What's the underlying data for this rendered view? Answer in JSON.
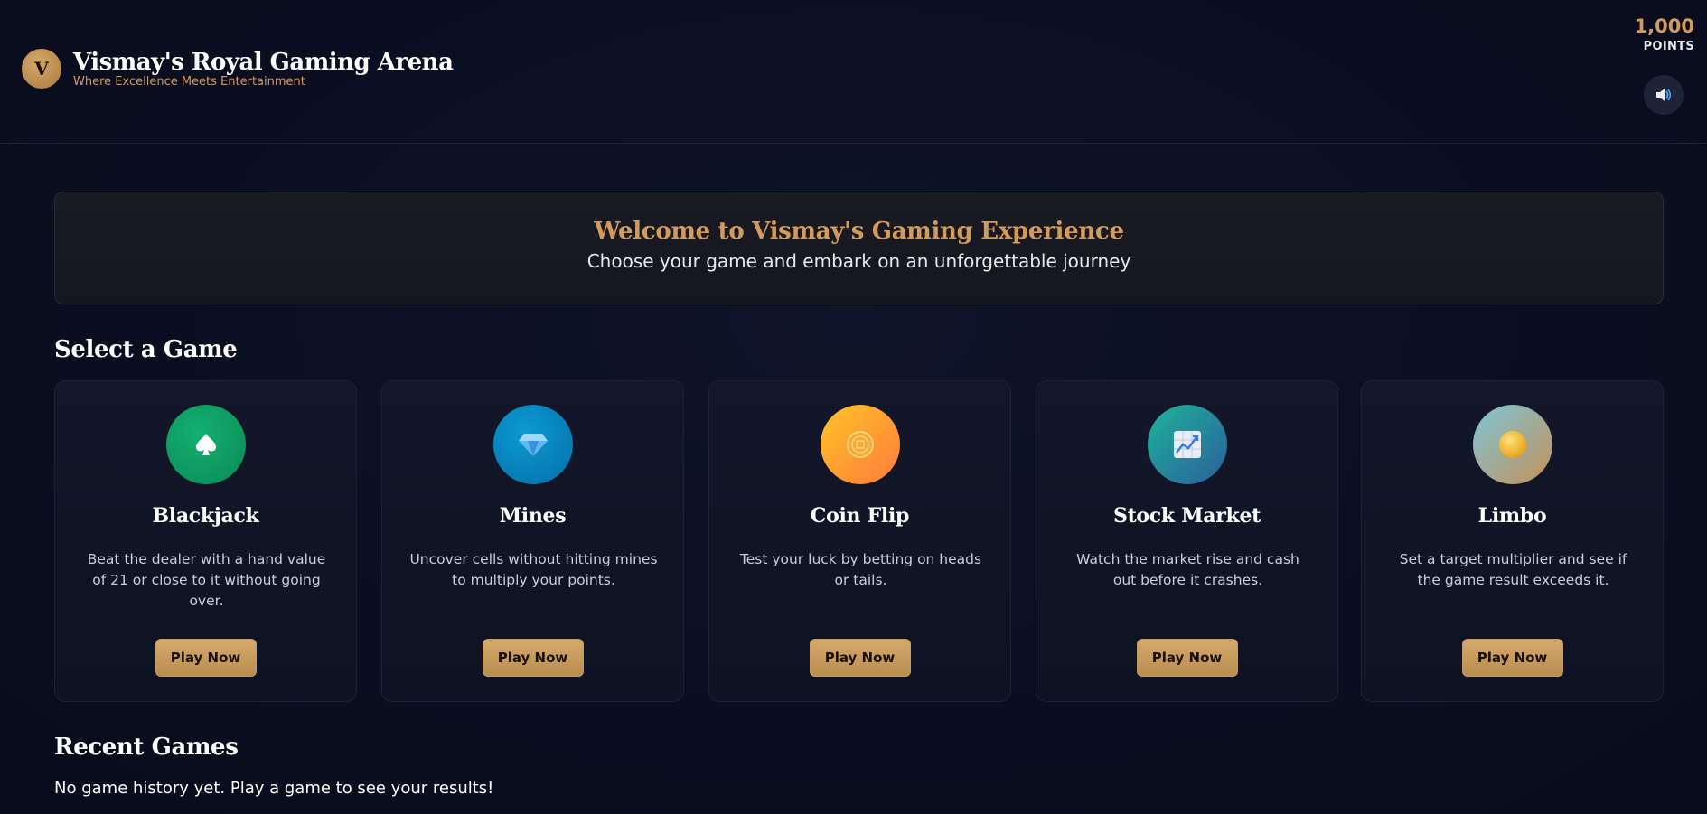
{
  "header": {
    "logo_letter": "V",
    "title": "Vismay's Royal Gaming Arena",
    "subtitle": "Where Excellence Meets Entertainment",
    "points_value": "1,000",
    "points_label": "POINTS",
    "sound_icon": "speaker-icon"
  },
  "welcome": {
    "title": "Welcome to Vismay's Gaming Experience",
    "subtitle": "Choose your game and embark on an unforgettable journey"
  },
  "games_section": {
    "title": "Select a Game",
    "games": [
      {
        "name": "Blackjack",
        "icon": "spade-icon",
        "description": "Beat the dealer with a hand value of 21 or close to it without going over.",
        "button": "Play Now"
      },
      {
        "name": "Mines",
        "icon": "diamond-icon",
        "description": "Uncover cells without hitting mines to multiply your points.",
        "button": "Play Now"
      },
      {
        "name": "Coin Flip",
        "icon": "coin-icon",
        "description": "Test your luck by betting on heads or tails.",
        "button": "Play Now"
      },
      {
        "name": "Stock Market",
        "icon": "chart-up-icon",
        "description": "Watch the market rise and cash out before it crashes.",
        "button": "Play Now"
      },
      {
        "name": "Limbo",
        "icon": "orb-icon",
        "description": "Set a target multiplier and see if the game result exceeds it.",
        "button": "Play Now"
      }
    ]
  },
  "recent": {
    "title": "Recent Games",
    "empty_message": "No game history yet. Play a game to see your results!"
  },
  "colors": {
    "accent": "#d39a5c",
    "background": "#0a0f22"
  }
}
